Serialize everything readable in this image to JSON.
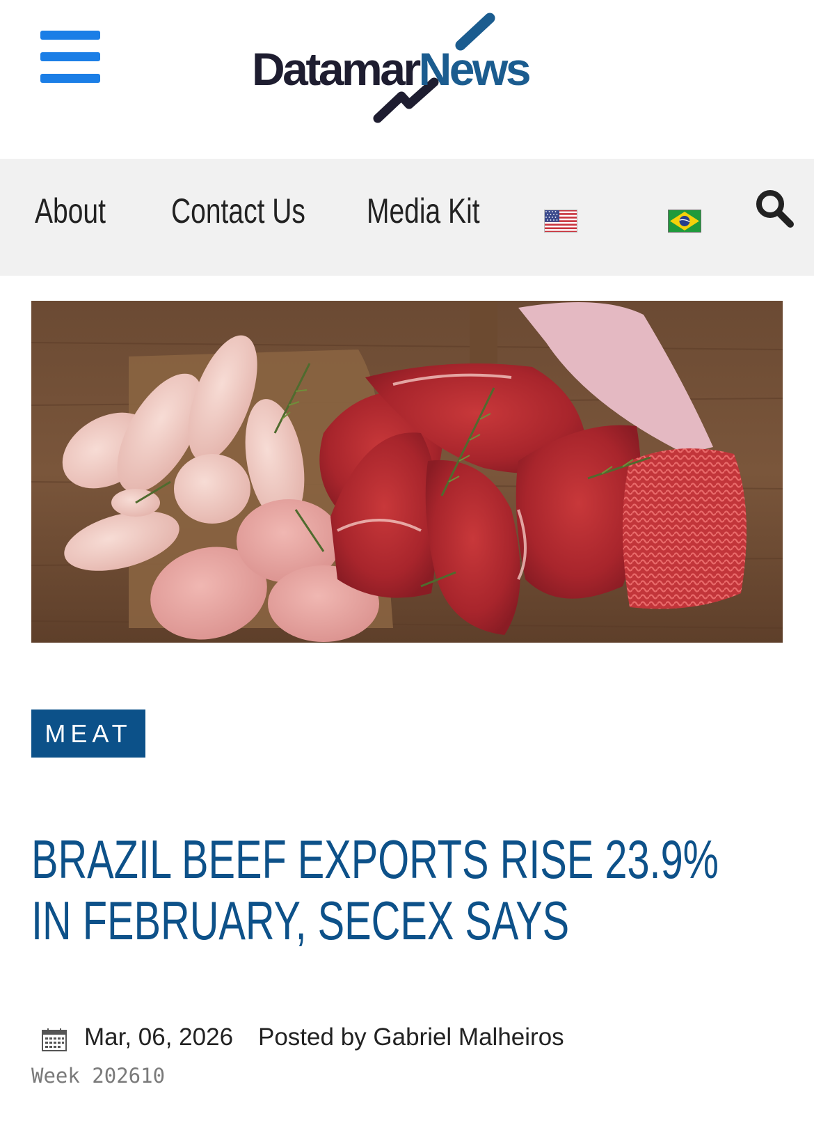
{
  "header": {
    "menu_icon": "hamburger-menu-icon",
    "logo": {
      "part1": "Datamar",
      "part2": "News",
      "colors": {
        "dark": "#1e1d30",
        "blue": "#1b5c8f"
      }
    }
  },
  "nav": {
    "items": [
      {
        "label": "About"
      },
      {
        "label": "Contact Us"
      },
      {
        "label": "Media Kit"
      }
    ],
    "languages": [
      {
        "icon": "us-flag-icon"
      },
      {
        "icon": "brazil-flag-icon"
      }
    ],
    "search_icon": "search-icon"
  },
  "article": {
    "hero_image": "assorted-raw-meat-photo",
    "category": "MEAT",
    "title": "BRAZIL BEEF EXPORTS RISE 23.9% IN FEBRUARY, SECEX SAYS",
    "date": "Mar, 06, 2026",
    "posted_by": "Posted by Gabriel Malheiros",
    "week": "Week 202610"
  },
  "colors": {
    "accent": "#1b7ee6",
    "brand_blue": "#0c5189",
    "nav_bg": "#f1f1f1"
  }
}
